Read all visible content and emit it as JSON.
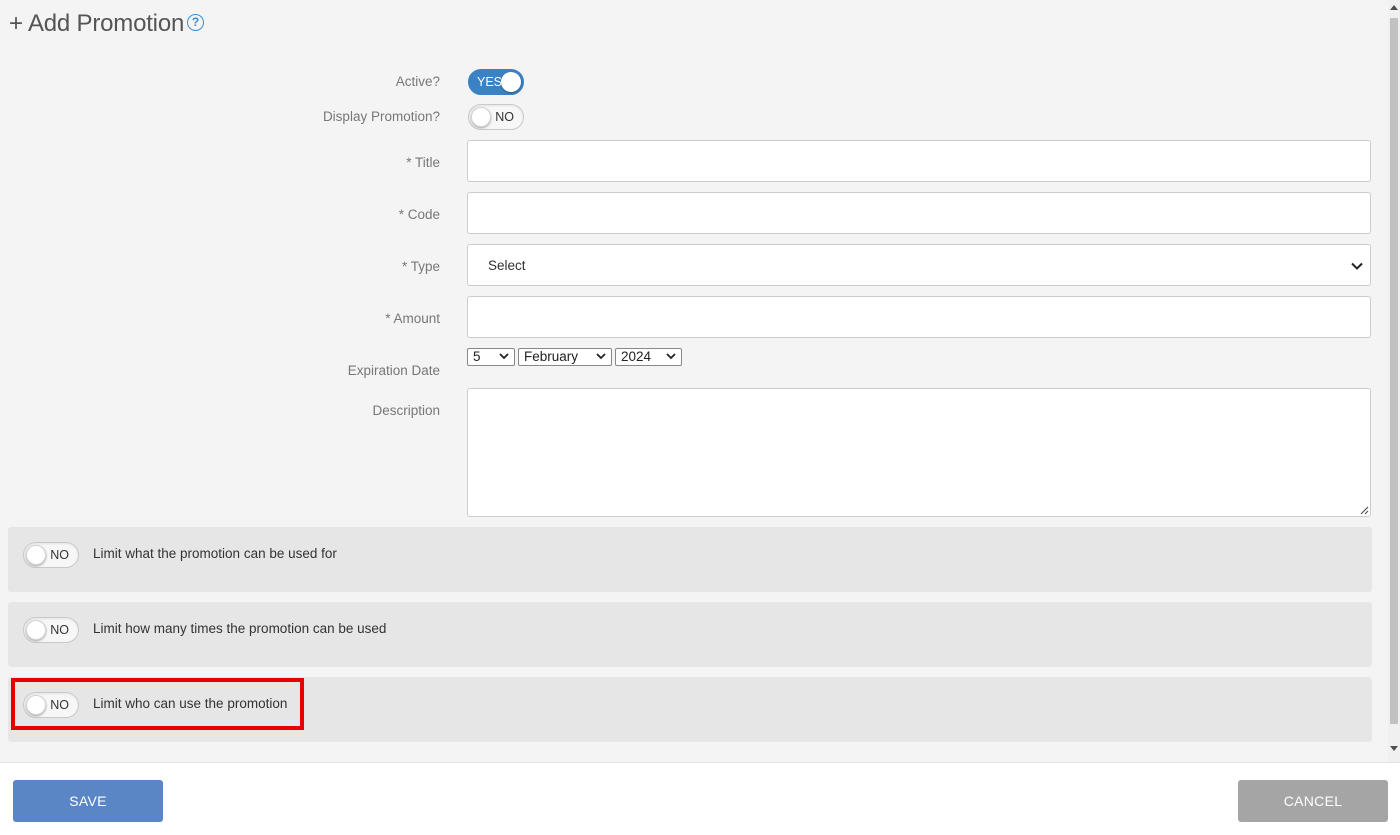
{
  "page": {
    "title": "+ Add Promotion",
    "help_icon_glyph": "?"
  },
  "form": {
    "active": {
      "label": "Active?",
      "value": "YES"
    },
    "display_promotion": {
      "label": "Display Promotion?",
      "value": "NO"
    },
    "title": {
      "label": "* Title",
      "value": ""
    },
    "code": {
      "label": "* Code",
      "value": ""
    },
    "type": {
      "label": "* Type",
      "value": "Select"
    },
    "amount": {
      "label": "* Amount",
      "value": ""
    },
    "expiration": {
      "label": "Expiration Date",
      "day": "5",
      "month": "February",
      "year": "2024"
    },
    "description": {
      "label": "Description",
      "value": ""
    }
  },
  "limits": [
    {
      "toggle": "NO",
      "label": "Limit what the promotion can be used for"
    },
    {
      "toggle": "NO",
      "label": "Limit how many times the promotion can be used"
    },
    {
      "toggle": "NO",
      "label": "Limit who can use the promotion"
    }
  ],
  "footer": {
    "save_label": "SAVE",
    "cancel_label": "CANCEL"
  },
  "colors": {
    "accent": "#3b82c4",
    "save": "#5b86c5",
    "cancel": "#a5a5a5",
    "highlight": "#e60000"
  }
}
